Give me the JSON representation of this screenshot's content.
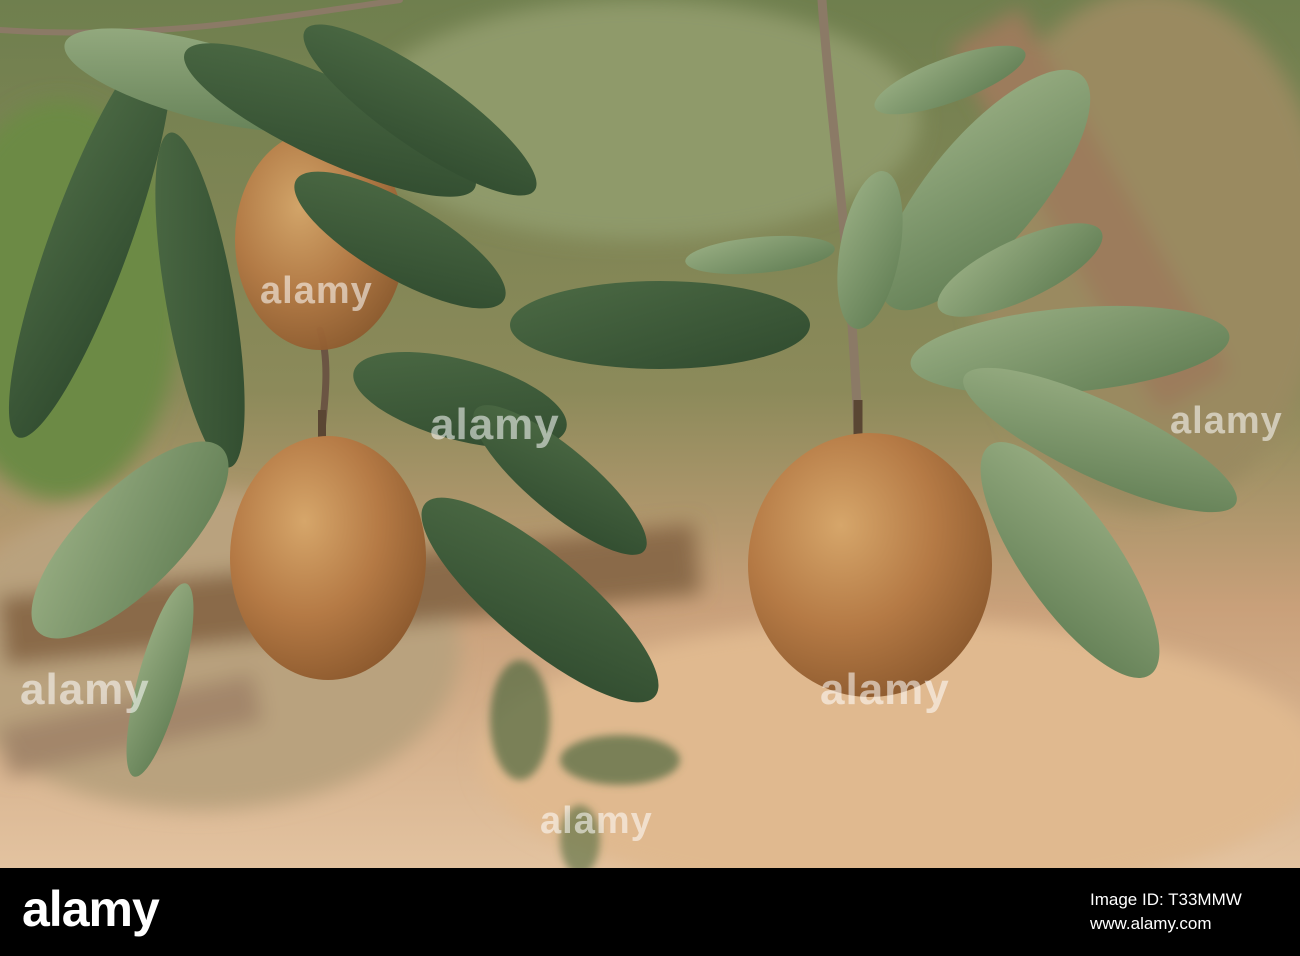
{
  "photo": {
    "subject": "sapodilla fruits hanging on tree branch",
    "palette": {
      "fruit_tan": "#b37a45",
      "fruit_highlight": "#d4a46a",
      "leaf_dark": "#3e5a3a",
      "leaf_light": "#7f9a6d",
      "background_warm": "#d7b08a",
      "background_foliage": "#7a8a58"
    }
  },
  "watermark": {
    "text": "alamy"
  },
  "footer": {
    "logo": "alamy",
    "image_id": "Image ID: T33MMW",
    "url": "www.alamy.com"
  }
}
